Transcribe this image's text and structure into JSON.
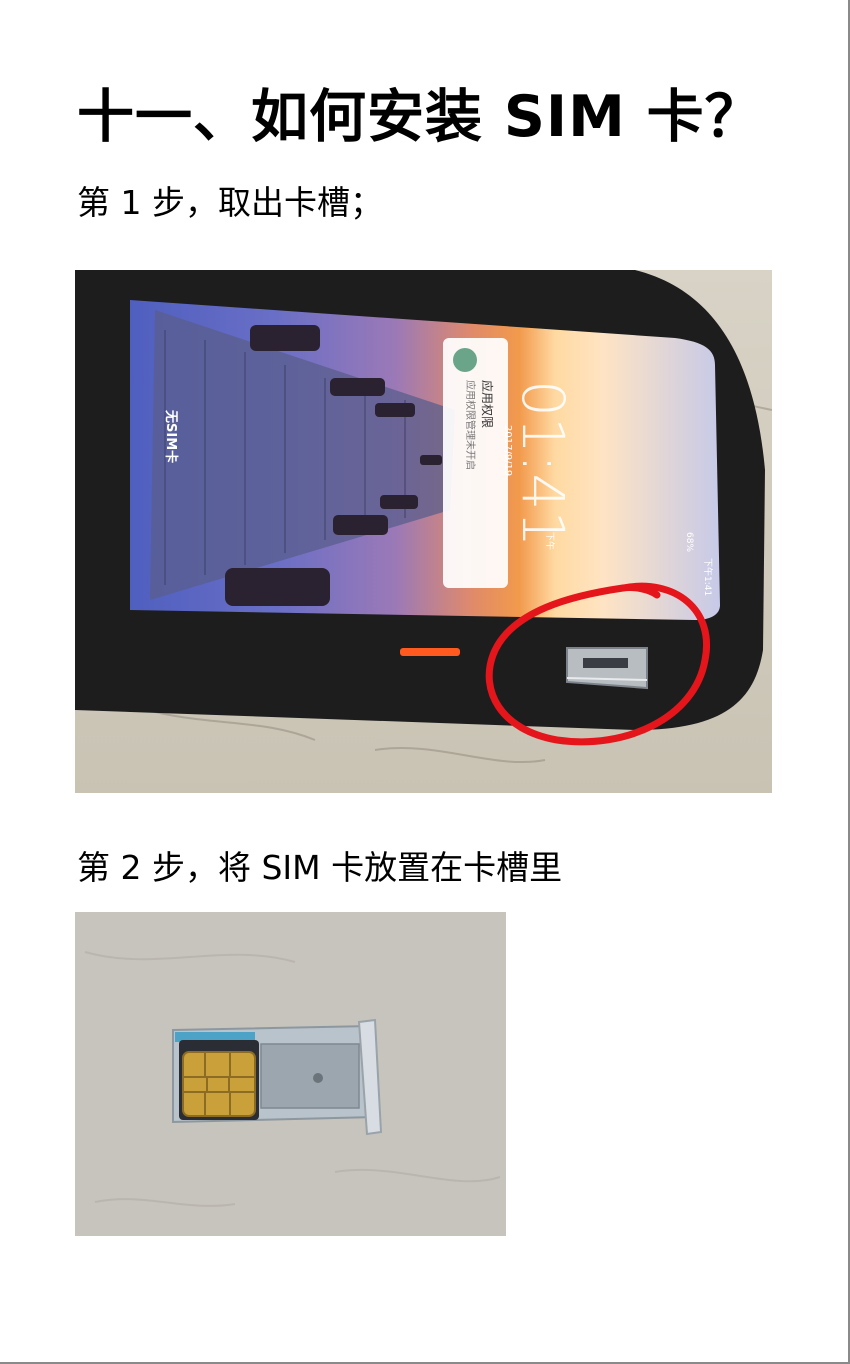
{
  "document": {
    "title": "十一、如何安装 SIM 卡？",
    "steps": [
      {
        "text": "第 1 步，取出卡槽；"
      },
      {
        "text": "第 2 步，将 SIM 卡放置在卡槽里"
      }
    ]
  },
  "photo1": {
    "screen_texts": {
      "no_sim": "无SIM卡",
      "time": "01:41",
      "date": "2017/9/19",
      "notif_title": "应用权限",
      "notif_body": "应用权限管理未开启",
      "status": "下午1:41",
      "battery": "68%",
      "ampm": "下午"
    }
  },
  "colors": {
    "annotation_circle": "#e5161b",
    "phone_body": "#1d1d1d",
    "tray_metal": "#b8bdc2",
    "sim_chip": "#c9a03a"
  }
}
